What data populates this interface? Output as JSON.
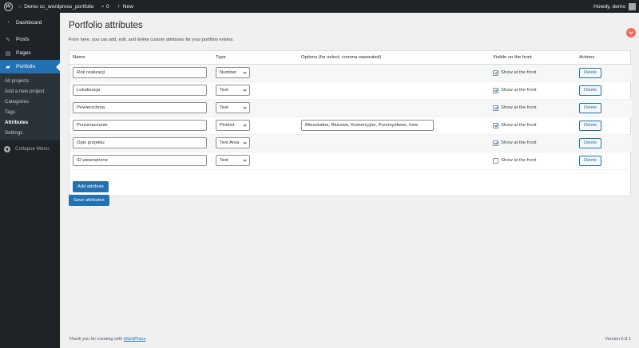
{
  "adminbar": {
    "site_name": "Demo cc_wordpress_portfolio",
    "comments_count": "0",
    "new_label": "New",
    "howdy": "Howdy, demo"
  },
  "sidebar": {
    "items": [
      {
        "label": "Dashboard",
        "icon": "dashboard-icon"
      },
      {
        "label": "Posts",
        "icon": "pin-icon"
      },
      {
        "label": "Pages",
        "icon": "pages-icon"
      },
      {
        "label": "Portfolio",
        "icon": "folder-icon"
      }
    ],
    "submenu": [
      "All projects",
      "Add a new project",
      "Categories",
      "Tags",
      "Attributes",
      "Settings"
    ],
    "collapse_label": "Collapse Menu"
  },
  "page": {
    "title": "Portfolio attributes",
    "intro": "From here, you can add, edit, and delete custom attributes for your portfolio entries."
  },
  "table": {
    "headers": {
      "name": "Name",
      "type": "Type",
      "options": "Options (for select, comma separated)",
      "visible": "Visible on the front",
      "actions": "Actions"
    },
    "rows": [
      {
        "name": "Rok realizacji",
        "type": "Number",
        "options": "",
        "visible": true
      },
      {
        "name": "Lokalizacja",
        "type": "Text",
        "options": "",
        "visible": true
      },
      {
        "name": "Powierzchnia",
        "type": "Text",
        "options": "",
        "visible": true
      },
      {
        "name": "Przeznaczenie",
        "type": "Picklist",
        "options": "Mieszkalne, Biurowe, Komercyjne, Przemysłowe, Inne",
        "visible": true
      },
      {
        "name": "Opis projektu",
        "type": "Text Area",
        "options": "",
        "visible": true
      },
      {
        "name": "ID wewnętrzne",
        "type": "Text",
        "options": "",
        "visible": false
      }
    ],
    "show_label": "Show at the front",
    "delete_label": "Delete"
  },
  "buttons": {
    "add_attribute": "Add attribute",
    "save_attributes": "Save attributes"
  },
  "footer": {
    "thanks_prefix": "Thank you for creating with ",
    "wordpress_link": "WordPress",
    "thanks_suffix": ".",
    "version": "Version 6.8.1"
  },
  "colors": {
    "admin_dark": "#1d2327",
    "accent": "#2271b1",
    "notification": "#ef6c59"
  }
}
